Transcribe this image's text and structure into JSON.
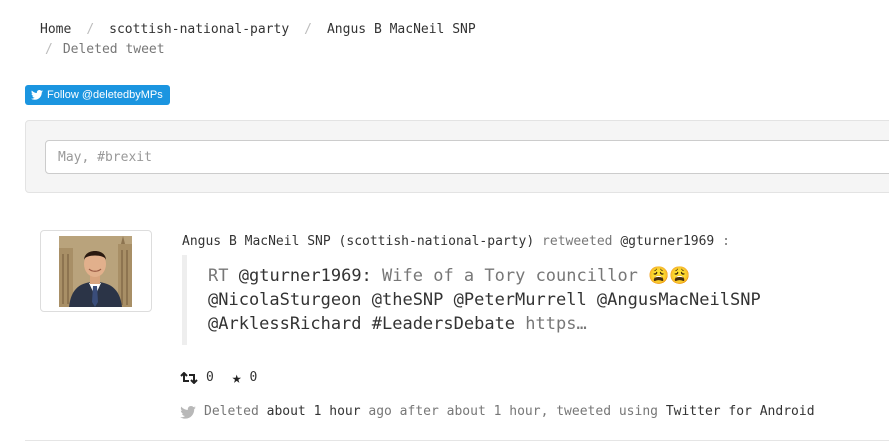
{
  "breadcrumb": {
    "home": "Home",
    "party": "scottish-national-party",
    "member": "Angus B MacNeil SNP",
    "current": "Deleted tweet",
    "separator": "/"
  },
  "follow_button": {
    "label": "Follow @deletedbyMPs",
    "icon": "twitter-bird-icon",
    "color": "#1b95e0"
  },
  "search": {
    "placeholder": "May, #brexit",
    "value": ""
  },
  "tweet": {
    "author": "Angus B MacNeil SNP",
    "party": "(scottish-national-party)",
    "action": "retweeted",
    "retweeted_user": "@gturner1969",
    "colon": ":",
    "text": {
      "rt_prefix": "RT",
      "handle": "@gturner1969:",
      "body1": "Wife of a Tory councillor 😩😩",
      "line2": "@NicolaSturgeon @theSNP @PeterMurrell @AngusMacNeilSNP",
      "line3_tags": "@ArklessRichard #LeadersDebate",
      "link": "https…"
    },
    "retweets": "0",
    "favorites": "0",
    "footer": {
      "deleted": "Deleted",
      "deleted_time": "about 1 hour",
      "ago_after": "ago after",
      "after_time": "about 1 hour,",
      "tweeted_using": "tweeted using",
      "client": "Twitter for Android"
    }
  }
}
